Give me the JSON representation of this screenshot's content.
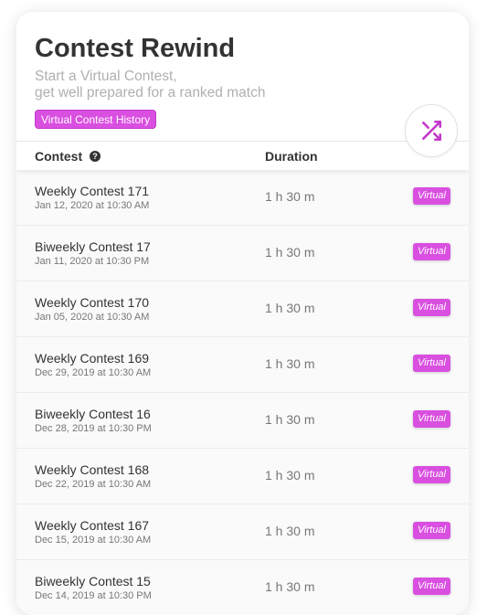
{
  "header": {
    "title": "Contest Rewind",
    "subtitle_line1": "Start a Virtual Contest,",
    "subtitle_line2": "get well prepared for a ranked match",
    "history_button": "Virtual Contest History",
    "shuffle_icon": "shuffle-icon"
  },
  "table": {
    "col_contest": "Contest",
    "col_duration": "Duration",
    "help_icon": "question-circle-icon",
    "rows": [
      {
        "name": "Weekly Contest 171",
        "date": "Jan 12, 2020 at 10:30 AM",
        "duration": "1 h 30 m",
        "badge": "Virtual"
      },
      {
        "name": "Biweekly Contest 17",
        "date": "Jan 11, 2020 at 10:30 PM",
        "duration": "1 h 30 m",
        "badge": "Virtual"
      },
      {
        "name": "Weekly Contest 170",
        "date": "Jan 05, 2020 at 10:30 AM",
        "duration": "1 h 30 m",
        "badge": "Virtual"
      },
      {
        "name": "Weekly Contest 169",
        "date": "Dec 29, 2019 at 10:30 AM",
        "duration": "1 h 30 m",
        "badge": "Virtual"
      },
      {
        "name": "Biweekly Contest 16",
        "date": "Dec 28, 2019 at 10:30 PM",
        "duration": "1 h 30 m",
        "badge": "Virtual"
      },
      {
        "name": "Weekly Contest 168",
        "date": "Dec 22, 2019 at 10:30 AM",
        "duration": "1 h 30 m",
        "badge": "Virtual"
      },
      {
        "name": "Weekly Contest 167",
        "date": "Dec 15, 2019 at 10:30 AM",
        "duration": "1 h 30 m",
        "badge": "Virtual"
      },
      {
        "name": "Biweekly Contest 15",
        "date": "Dec 14, 2019 at 10:30 PM",
        "duration": "1 h 30 m",
        "badge": "Virtual"
      }
    ]
  },
  "colors": {
    "accent": "#d94fe0",
    "title": "#333333",
    "muted": "#b0b0b0"
  }
}
